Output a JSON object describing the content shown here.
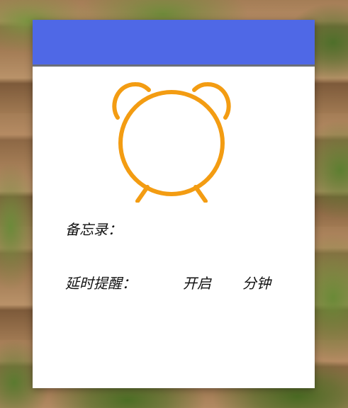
{
  "header": {
    "color": "#4f68e6"
  },
  "clock": {
    "icon": "alarm-clock-icon",
    "color": "#f39c12"
  },
  "memo": {
    "label": "备忘录：",
    "value": ""
  },
  "delay": {
    "label": "延时提醒：",
    "toggle_label": "开启",
    "minutes_value": "",
    "unit_label": "分钟"
  }
}
